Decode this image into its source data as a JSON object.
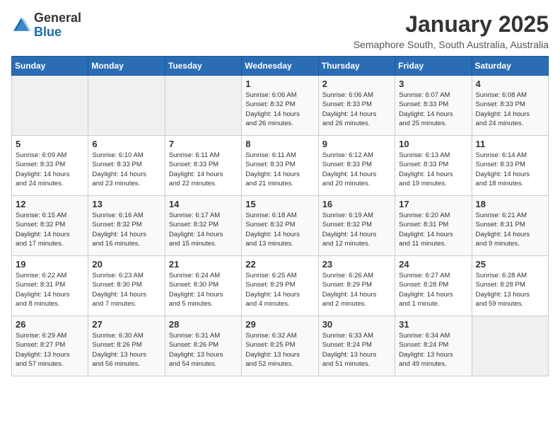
{
  "logo": {
    "general": "General",
    "blue": "Blue"
  },
  "title": "January 2025",
  "subtitle": "Semaphore South, South Australia, Australia",
  "days_header": [
    "Sunday",
    "Monday",
    "Tuesday",
    "Wednesday",
    "Thursday",
    "Friday",
    "Saturday"
  ],
  "weeks": [
    [
      {
        "day": "",
        "info": ""
      },
      {
        "day": "",
        "info": ""
      },
      {
        "day": "",
        "info": ""
      },
      {
        "day": "1",
        "info": "Sunrise: 6:06 AM\nSunset: 8:32 PM\nDaylight: 14 hours\nand 26 minutes."
      },
      {
        "day": "2",
        "info": "Sunrise: 6:06 AM\nSunset: 8:33 PM\nDaylight: 14 hours\nand 26 minutes."
      },
      {
        "day": "3",
        "info": "Sunrise: 6:07 AM\nSunset: 8:33 PM\nDaylight: 14 hours\nand 25 minutes."
      },
      {
        "day": "4",
        "info": "Sunrise: 6:08 AM\nSunset: 8:33 PM\nDaylight: 14 hours\nand 24 minutes."
      }
    ],
    [
      {
        "day": "5",
        "info": "Sunrise: 6:09 AM\nSunset: 8:33 PM\nDaylight: 14 hours\nand 24 minutes."
      },
      {
        "day": "6",
        "info": "Sunrise: 6:10 AM\nSunset: 8:33 PM\nDaylight: 14 hours\nand 23 minutes."
      },
      {
        "day": "7",
        "info": "Sunrise: 6:11 AM\nSunset: 8:33 PM\nDaylight: 14 hours\nand 22 minutes."
      },
      {
        "day": "8",
        "info": "Sunrise: 6:11 AM\nSunset: 8:33 PM\nDaylight: 14 hours\nand 21 minutes."
      },
      {
        "day": "9",
        "info": "Sunrise: 6:12 AM\nSunset: 8:33 PM\nDaylight: 14 hours\nand 20 minutes."
      },
      {
        "day": "10",
        "info": "Sunrise: 6:13 AM\nSunset: 8:33 PM\nDaylight: 14 hours\nand 19 minutes."
      },
      {
        "day": "11",
        "info": "Sunrise: 6:14 AM\nSunset: 8:33 PM\nDaylight: 14 hours\nand 18 minutes."
      }
    ],
    [
      {
        "day": "12",
        "info": "Sunrise: 6:15 AM\nSunset: 8:32 PM\nDaylight: 14 hours\nand 17 minutes."
      },
      {
        "day": "13",
        "info": "Sunrise: 6:16 AM\nSunset: 8:32 PM\nDaylight: 14 hours\nand 16 minutes."
      },
      {
        "day": "14",
        "info": "Sunrise: 6:17 AM\nSunset: 8:32 PM\nDaylight: 14 hours\nand 15 minutes."
      },
      {
        "day": "15",
        "info": "Sunrise: 6:18 AM\nSunset: 8:32 PM\nDaylight: 14 hours\nand 13 minutes."
      },
      {
        "day": "16",
        "info": "Sunrise: 6:19 AM\nSunset: 8:32 PM\nDaylight: 14 hours\nand 12 minutes."
      },
      {
        "day": "17",
        "info": "Sunrise: 6:20 AM\nSunset: 8:31 PM\nDaylight: 14 hours\nand 11 minutes."
      },
      {
        "day": "18",
        "info": "Sunrise: 6:21 AM\nSunset: 8:31 PM\nDaylight: 14 hours\nand 9 minutes."
      }
    ],
    [
      {
        "day": "19",
        "info": "Sunrise: 6:22 AM\nSunset: 8:31 PM\nDaylight: 14 hours\nand 8 minutes."
      },
      {
        "day": "20",
        "info": "Sunrise: 6:23 AM\nSunset: 8:30 PM\nDaylight: 14 hours\nand 7 minutes."
      },
      {
        "day": "21",
        "info": "Sunrise: 6:24 AM\nSunset: 8:30 PM\nDaylight: 14 hours\nand 5 minutes."
      },
      {
        "day": "22",
        "info": "Sunrise: 6:25 AM\nSunset: 8:29 PM\nDaylight: 14 hours\nand 4 minutes."
      },
      {
        "day": "23",
        "info": "Sunrise: 6:26 AM\nSunset: 8:29 PM\nDaylight: 14 hours\nand 2 minutes."
      },
      {
        "day": "24",
        "info": "Sunrise: 6:27 AM\nSunset: 8:28 PM\nDaylight: 14 hours\nand 1 minute."
      },
      {
        "day": "25",
        "info": "Sunrise: 6:28 AM\nSunset: 8:28 PM\nDaylight: 13 hours\nand 59 minutes."
      }
    ],
    [
      {
        "day": "26",
        "info": "Sunrise: 6:29 AM\nSunset: 8:27 PM\nDaylight: 13 hours\nand 57 minutes."
      },
      {
        "day": "27",
        "info": "Sunrise: 6:30 AM\nSunset: 8:26 PM\nDaylight: 13 hours\nand 56 minutes."
      },
      {
        "day": "28",
        "info": "Sunrise: 6:31 AM\nSunset: 8:26 PM\nDaylight: 13 hours\nand 54 minutes."
      },
      {
        "day": "29",
        "info": "Sunrise: 6:32 AM\nSunset: 8:25 PM\nDaylight: 13 hours\nand 52 minutes."
      },
      {
        "day": "30",
        "info": "Sunrise: 6:33 AM\nSunset: 8:24 PM\nDaylight: 13 hours\nand 51 minutes."
      },
      {
        "day": "31",
        "info": "Sunrise: 6:34 AM\nSunset: 8:24 PM\nDaylight: 13 hours\nand 49 minutes."
      },
      {
        "day": "",
        "info": ""
      }
    ]
  ]
}
